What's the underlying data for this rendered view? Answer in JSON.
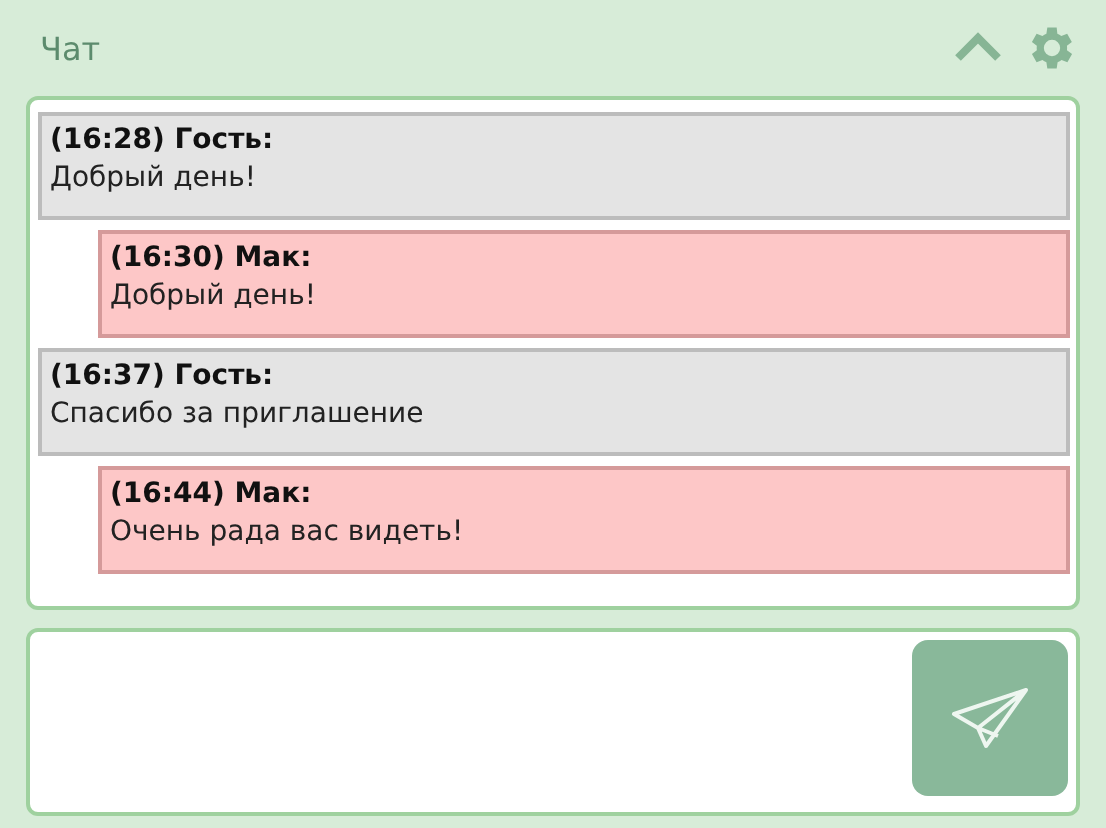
{
  "header": {
    "title": "Чат",
    "collapsed": false
  },
  "messages": [
    {
      "kind": "guest",
      "head": "(16:28) Гость:",
      "text": "Добрый день!"
    },
    {
      "kind": "own",
      "head": "(16:30) Мак:",
      "text": "Добрый день!"
    },
    {
      "kind": "guest",
      "head": "(16:37) Гость:",
      "text": "Спасибо за приглашение"
    },
    {
      "kind": "own",
      "head": "(16:44) Мак:",
      "text": "Очень рада вас видеть!"
    }
  ]
}
